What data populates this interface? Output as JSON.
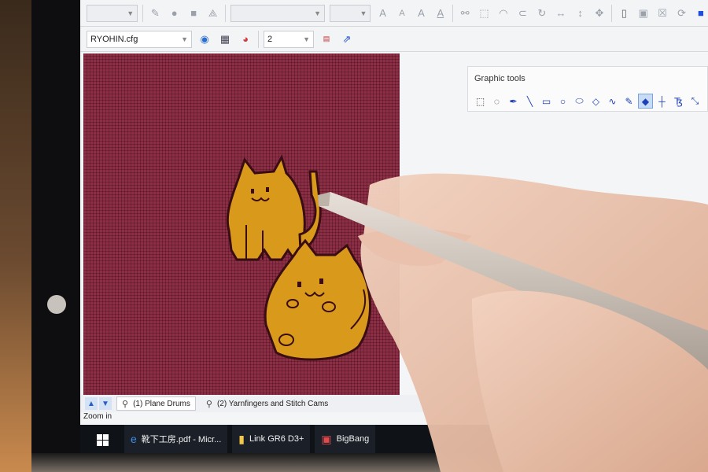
{
  "toolbar": {
    "row1_icons": [
      "pencil-icon",
      "circle-fill-icon",
      "square-fill-icon",
      "node-icon",
      "font-a-icon",
      "font-a-small-icon",
      "font-a-outline-icon",
      "font-a-underline-icon"
    ],
    "cfg_select": "RYOHIN.cfg",
    "page_select": "2"
  },
  "graphic_tools": {
    "title": "Graphic tools",
    "tools": [
      "rect-select-icon",
      "lasso-icon",
      "pen-icon",
      "line-icon",
      "rectangle-icon",
      "ellipse-icon",
      "oval-icon",
      "diamond-icon",
      "curve-icon",
      "brush-icon",
      "fill-icon",
      "cross-icon",
      "text-icon",
      "transform-icon"
    ]
  },
  "layers": {
    "tab1": "(1)  Plane Drums",
    "tab2": "(2)  Yarnfingers and Stitch Cams"
  },
  "status": "Zoom in",
  "taskbar": {
    "items": [
      {
        "icon": "edge-icon",
        "label": "靴下工房.pdf - Micr..."
      },
      {
        "icon": "folder-icon",
        "label": "Link GR6 D3+"
      },
      {
        "icon": "app-icon",
        "label": "BigBang"
      }
    ]
  },
  "colors": {
    "canvas_bg": "#8c2f45",
    "cat_fill": "#d99a1c",
    "outline": "#3a0d14",
    "accent": "#1e4fd8"
  }
}
